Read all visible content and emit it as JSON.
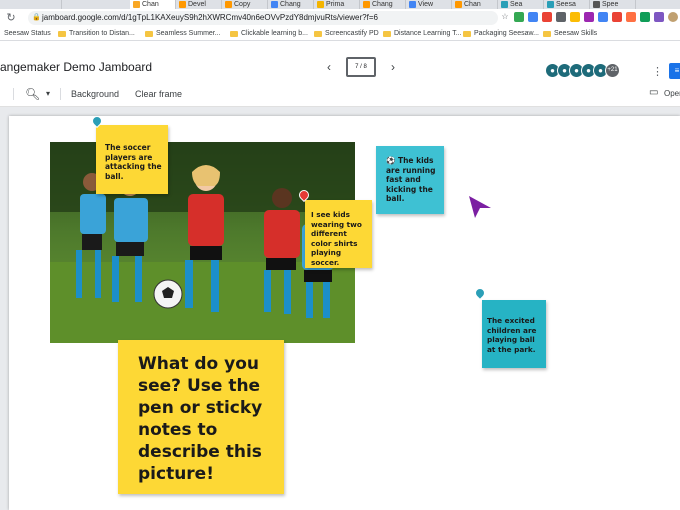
{
  "browser": {
    "tabs": [
      {
        "label": "Chan",
        "color": "#f9a825",
        "active": true
      },
      {
        "label": "Devel",
        "color": "#ff9800"
      },
      {
        "label": "Copy",
        "color": "#ff9800"
      },
      {
        "label": "Chang",
        "color": "#4285f4"
      },
      {
        "label": "Prima",
        "color": "#f4b400"
      },
      {
        "label": "Chang",
        "color": "#ff9800"
      },
      {
        "label": "View",
        "color": "#4285f4"
      },
      {
        "label": "Chan",
        "color": "#ff9800"
      },
      {
        "label": "Sea",
        "color": "#2b9fb7"
      },
      {
        "label": "Seesa",
        "color": "#2b9fb7"
      },
      {
        "label": "Spee",
        "color": "#555555"
      }
    ],
    "url": "jamboard.google.com/d/1gTpL1KAXeuyS9h2hXWRCmv40n6eOVvPzdY8dmjvuRts/viewer?f=6"
  },
  "bookmarks": [
    "Seesaw Status",
    "Transition to Distan...",
    "Seamless Summer...",
    "Clickable learning b...",
    "Screencastify PD",
    "Distance Learning T...",
    "Packaging Seesaw...",
    "Seesaw Skills"
  ],
  "jamboard": {
    "title": "angemaker Demo Jamboard",
    "frame_indicator": "7 / 8",
    "collaborators_more": "+21",
    "toolbar": {
      "background": "Background",
      "clear_frame": "Clear frame",
      "open": "Oper"
    }
  },
  "stickies": {
    "soccer": "The soccer players are attacking the ball.",
    "running": "⚽ The kids are running fast and kicking the ball.",
    "two_colors": "I see kids wearing two different color shirts playing soccer.",
    "excited": "The excited children are playing ball at the park.",
    "prompt": "What do you see? Use the pen or sticky notes to describe this picture!"
  },
  "colors": {
    "yellow_sticky": "#fdd835",
    "teal_sticky": "#3ec1d3",
    "teal_dark": "#26b3c4",
    "cursor": "#7b1fa2"
  }
}
